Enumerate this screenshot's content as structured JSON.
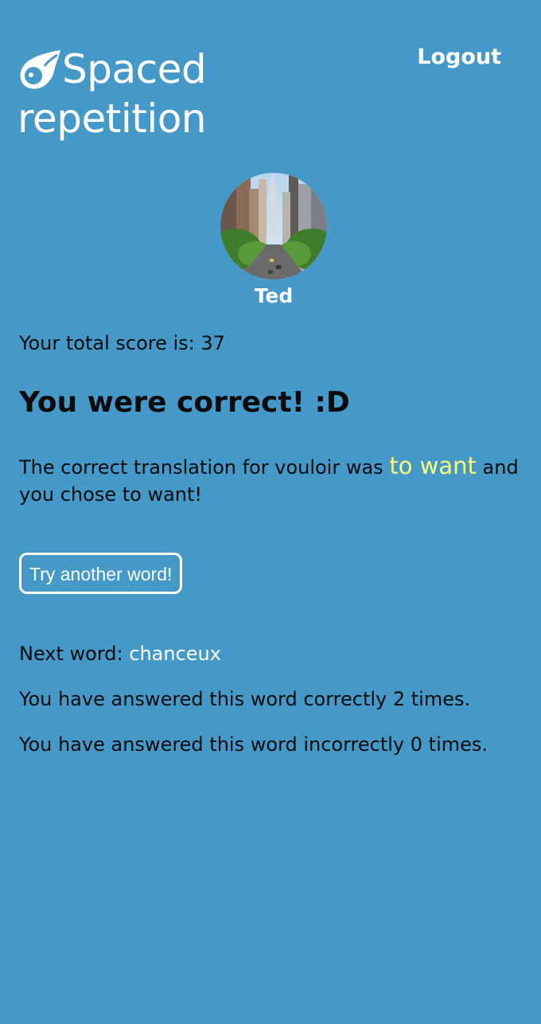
{
  "header": {
    "logo_line1": "Spaced",
    "logo_line2": "repetition",
    "logout_label": "Logout"
  },
  "profile": {
    "username": "Ted"
  },
  "main": {
    "score_label": "Your total score is: 37",
    "result_heading": "You were correct! :D",
    "translation_prefix": "The correct translation for vouloir was",
    "translation_answer": "to want",
    "translation_suffix": "and you chose to want!",
    "try_button_label": "Try another word!",
    "next_word_label": "Next word:",
    "next_word_value": "chanceux",
    "correct_count_text": "You have answered this word correctly 2 times.",
    "incorrect_count_text": "You have answered this word incorrectly 0 times."
  },
  "colors": {
    "background": "#4599c8",
    "highlight": "#fafd79",
    "text": "#0a0a0a",
    "white": "#ffffff"
  }
}
